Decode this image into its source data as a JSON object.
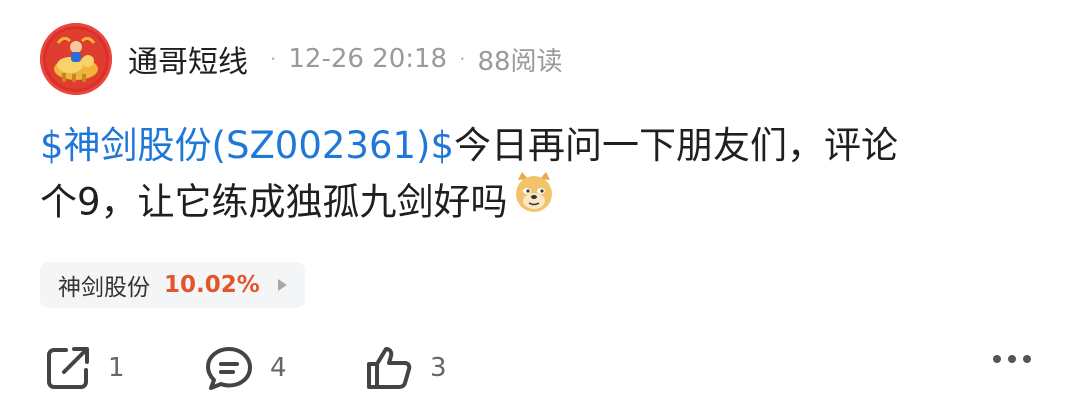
{
  "post": {
    "author": "通哥短线",
    "separator": "·",
    "timestamp": "12-26 20:18",
    "views": "88阅读",
    "content_line1_link": "$神剑股份(SZ002361)$",
    "content_line1_text": "今日再问一下朋友们，评论",
    "content_line2_text": "个9，让它练成独孤九剑好吗",
    "emoji": "doge-emoji"
  },
  "stock_tag": {
    "name": "神剑股份",
    "change": "10.02%",
    "change_color": "#e4562a"
  },
  "actions": {
    "share_count": "1",
    "comment_count": "4",
    "like_count": "3"
  },
  "icons": [
    "share-icon",
    "comment-icon",
    "like-icon",
    "more-icon",
    "play-arrow-icon"
  ],
  "colors": {
    "link": "#1f78d8",
    "avatar_bg": "#d9302a"
  }
}
